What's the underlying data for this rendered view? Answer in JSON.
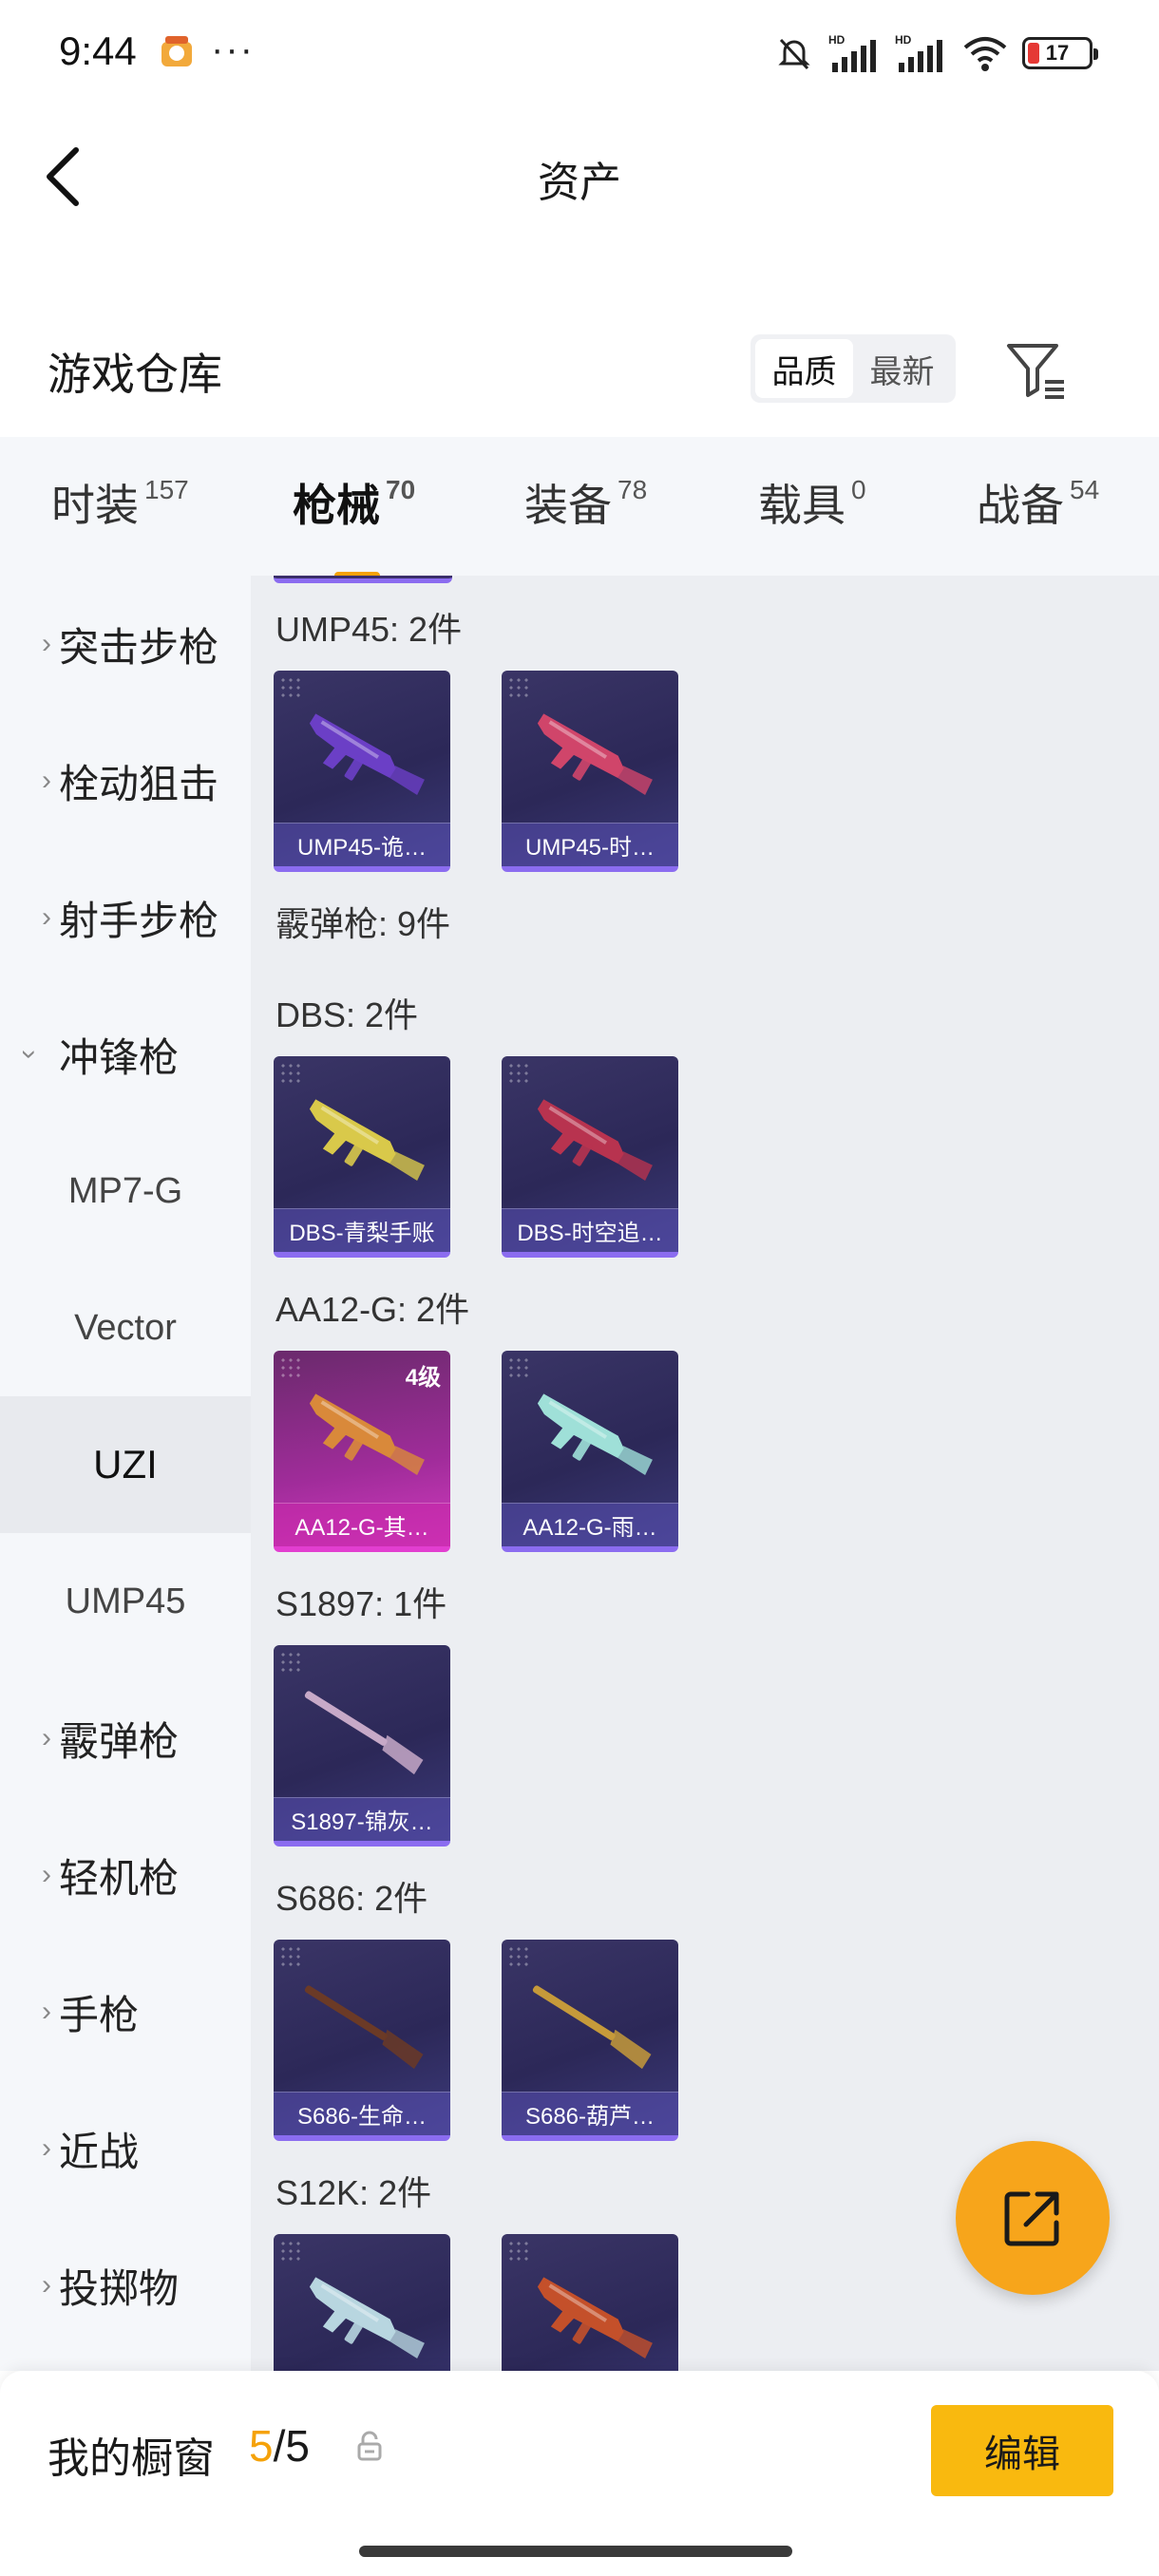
{
  "status_bar": {
    "time": "9:44",
    "dots": "···",
    "battery": "17",
    "icons": [
      "app-badge-icon",
      "mute-icon",
      "signal-hd-icon",
      "signal-hd-icon",
      "wifi-icon",
      "battery-icon"
    ]
  },
  "header": {
    "title": "资产",
    "back_icon": "back-arrow-icon"
  },
  "warehouse": {
    "title": "游戏仓库",
    "sort_options": [
      "品质",
      "最新"
    ],
    "sort_selected": "品质",
    "filter_icon": "filter-icon"
  },
  "tabs": [
    {
      "label": "时装",
      "count": "157"
    },
    {
      "label": "枪械",
      "count": "70",
      "active": true
    },
    {
      "label": "装备",
      "count": "78"
    },
    {
      "label": "载具",
      "count": "0"
    },
    {
      "label": "战备",
      "count": "54"
    }
  ],
  "sidebar": {
    "items": [
      {
        "label": "突击步枪",
        "expandable": true
      },
      {
        "label": "栓动狙击",
        "expandable": true
      },
      {
        "label": "射手步枪",
        "expandable": true
      },
      {
        "label": "冲锋枪",
        "expandable": true,
        "expanded": true
      },
      {
        "label": "MP7-G",
        "sub": true
      },
      {
        "label": "Vector",
        "sub": true
      },
      {
        "label": "UZI",
        "sub": true,
        "selected": true
      },
      {
        "label": "UMP45",
        "sub": true
      },
      {
        "label": "霰弹枪",
        "expandable": true
      },
      {
        "label": "轻机枪",
        "expandable": true
      },
      {
        "label": "手枪",
        "expandable": true
      },
      {
        "label": "近战",
        "expandable": true
      },
      {
        "label": "投掷物",
        "expandable": true
      }
    ]
  },
  "content": {
    "labels": {
      "ump45": "UMP45: 2件",
      "shotgun_category": "霰弹枪: 9件",
      "dbs": "DBS: 2件",
      "aa12": "AA12-G: 2件",
      "s1897": "S1897: 1件",
      "s686": "S686: 2件",
      "s12k": "S12K: 2件"
    },
    "cards": {
      "ump45_1": {
        "name": "UMP45-诡…",
        "color": "#6b3fc6"
      },
      "ump45_2": {
        "name": "UMP45-时…",
        "color": "#d0456a"
      },
      "dbs_1": {
        "name": "DBS-青梨手账",
        "color": "#d9c94a"
      },
      "dbs_2": {
        "name": "DBS-时空追…",
        "color": "#b8334f"
      },
      "aa12_1": {
        "name": "AA12-G-其…",
        "color": "#d9893a",
        "level": "4级"
      },
      "aa12_2": {
        "name": "AA12-G-雨…",
        "color": "#9fe0d8"
      },
      "s1897_1": {
        "name": "S1897-锦灰…",
        "color": "#c7a9c8"
      },
      "s686_1": {
        "name": "S686-生命…",
        "color": "#6b3a26"
      },
      "s686_2": {
        "name": "S686-葫芦…",
        "color": "#c69a3a"
      },
      "s12k_1": {
        "name": "",
        "color": "#b8d6e0"
      },
      "s12k_2": {
        "name": "",
        "color": "#c4502a"
      }
    }
  },
  "fab": {
    "icon": "share-external-icon"
  },
  "bottom_bar": {
    "label": "我的橱窗",
    "count_current": "5",
    "count_separator": "/",
    "count_total": "5",
    "lock_icon": "lock-icon",
    "edit_label": "编辑"
  },
  "colors": {
    "accent": "#f5a20a",
    "edit_button": "#f9b90f",
    "fab": "#f7a51b",
    "card_epic": "#8b6cf0",
    "card_legend": "#e23ed0"
  }
}
